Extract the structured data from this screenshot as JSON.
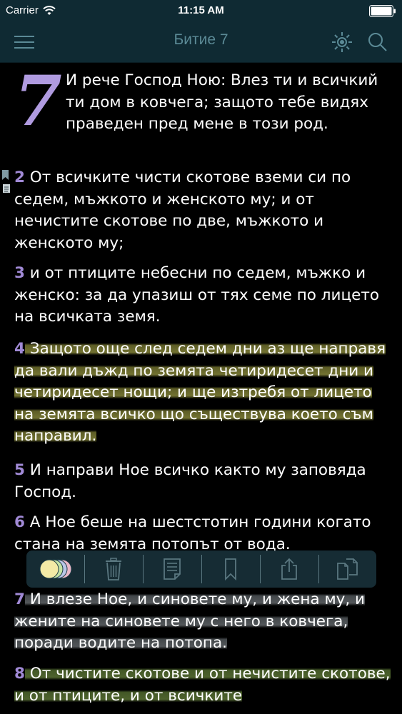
{
  "status_bar": {
    "carrier": "Carrier",
    "time": "11:15 AM"
  },
  "nav": {
    "title": "Битие 7",
    "icons": [
      "menu-icon",
      "brightness-icon",
      "search-icon"
    ]
  },
  "chapter": {
    "number": "7",
    "verses": [
      {
        "num": "",
        "text": "И рече Господ Ною: Влез ти и всичкий ти дом в ковчега; защото тебе видях праведен пред мене в този род.",
        "highlight": "none"
      },
      {
        "num": "2",
        "text": " От всичките чисти скотове вземи си по седем, мъжкото и женското му; и от нечистите скотове по две, мъжкото и женското му;",
        "highlight": "none"
      },
      {
        "num": "3",
        "text": " и от птиците небесни по седем, мъжко и женско: за да упазиш от тях семе по лицето на всичката земя.",
        "highlight": "none"
      },
      {
        "num": "4",
        "text": " Защото още след седем дни аз ще направя да вали дъжд по земята четиридесет дни и четиридесет нощи; и ще изтребя от лицето на земята всичко що съществува което съм направил.",
        "highlight": "yellow"
      },
      {
        "num": "5",
        "text": " И направи Ное всичко както му заповяда Господ.",
        "highlight": "none"
      },
      {
        "num": "6",
        "text": " А Ное беше на шестстотин години когато стана на земята потопът от вода.",
        "highlight": "none"
      },
      {
        "num": "7",
        "text": " И влезе Ное, и синовете му, и жена му, и жените на синовете му с него в ковчега, поради водите на потопа.",
        "highlight": "gray"
      },
      {
        "num": "8",
        "text": " От чистите скотове и от нечистите скотове, и от птиците, и от всичките",
        "highlight": "green"
      }
    ]
  },
  "toolbar": {
    "items": [
      "color-picker-icon",
      "trash-icon",
      "note-icon",
      "bookmark-icon",
      "share-icon",
      "copy-icon"
    ],
    "color_swatches": [
      "#f3eaa6",
      "#c4e3a6",
      "#b9c6e6",
      "#e9b9c9"
    ]
  }
}
